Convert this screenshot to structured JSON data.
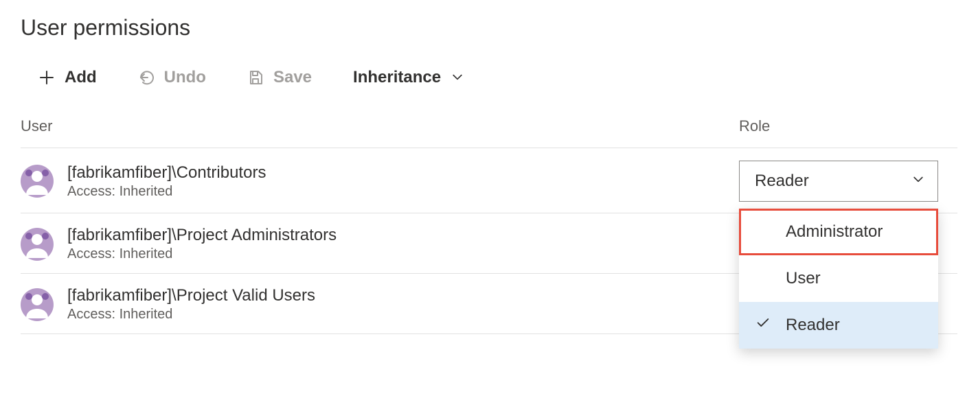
{
  "title": "User permissions",
  "toolbar": {
    "add": "Add",
    "undo": "Undo",
    "save": "Save",
    "inheritance": "Inheritance"
  },
  "columns": {
    "user": "User",
    "role": "Role"
  },
  "access_label_prefix": "Access: ",
  "users": [
    {
      "name": "[fabrikamfiber]\\Contributors",
      "access": "Inherited",
      "role": "Reader",
      "dropdown_open": true
    },
    {
      "name": "[fabrikamfiber]\\Project Administrators",
      "access": "Inherited"
    },
    {
      "name": "[fabrikamfiber]\\Project Valid Users",
      "access": "Inherited"
    }
  ],
  "role_options": {
    "admin": "Administrator",
    "user": "User",
    "reader": "Reader"
  }
}
